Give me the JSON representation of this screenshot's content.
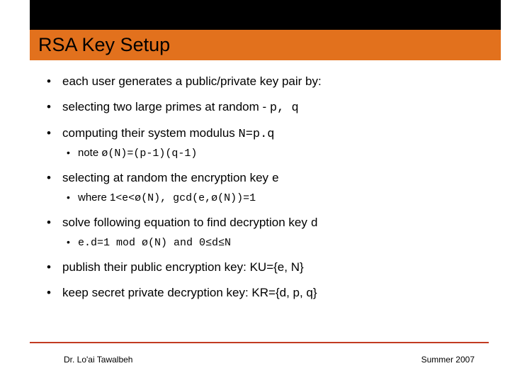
{
  "slide": {
    "title": "RSA Key Setup",
    "bullets": [
      {
        "text": "each user generates a public/private key pair by:"
      },
      {
        "pre": "selecting two large primes at random - ",
        "mono": "p, q"
      },
      {
        "pre": "computing their system modulus ",
        "mono": "N=p.q",
        "sub": [
          {
            "pre": "note ",
            "mono": "ø(N)=(p-1)(q-1)"
          }
        ]
      },
      {
        "pre": "selecting at random the encryption key ",
        "mono": "e",
        "sub": [
          {
            "pre": "where 1<",
            "mono": "e<ø(N), gcd(e,ø(N))=1"
          }
        ]
      },
      {
        "pre": "solve following equation to find decryption key ",
        "mono": "d",
        "sub": [
          {
            "mono": "e.d=1 mod ø(N) and 0≤d≤N"
          }
        ]
      },
      {
        "text": "publish their public encryption key: KU={e, N}"
      },
      {
        "text": "keep secret private decryption key: KR={d, p, q}"
      }
    ]
  },
  "footer": {
    "left": "Dr. Lo'ai Tawalbeh",
    "right": "Summer 2007"
  }
}
